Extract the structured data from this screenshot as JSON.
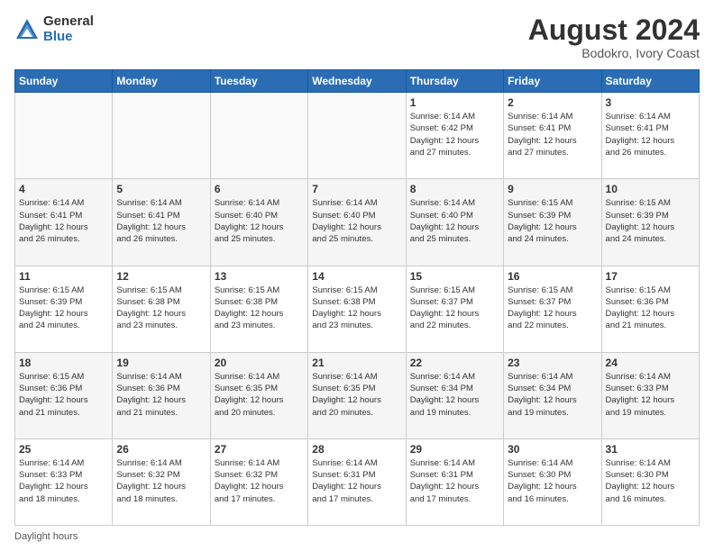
{
  "logo": {
    "general": "General",
    "blue": "Blue"
  },
  "title": {
    "month": "August 2024",
    "location": "Bodokro, Ivory Coast"
  },
  "weekdays": [
    "Sunday",
    "Monday",
    "Tuesday",
    "Wednesday",
    "Thursday",
    "Friday",
    "Saturday"
  ],
  "footer": "Daylight hours",
  "weeks": [
    [
      {
        "day": "",
        "info": ""
      },
      {
        "day": "",
        "info": ""
      },
      {
        "day": "",
        "info": ""
      },
      {
        "day": "",
        "info": ""
      },
      {
        "day": "1",
        "info": "Sunrise: 6:14 AM\nSunset: 6:42 PM\nDaylight: 12 hours\nand 27 minutes."
      },
      {
        "day": "2",
        "info": "Sunrise: 6:14 AM\nSunset: 6:41 PM\nDaylight: 12 hours\nand 27 minutes."
      },
      {
        "day": "3",
        "info": "Sunrise: 6:14 AM\nSunset: 6:41 PM\nDaylight: 12 hours\nand 26 minutes."
      }
    ],
    [
      {
        "day": "4",
        "info": "Sunrise: 6:14 AM\nSunset: 6:41 PM\nDaylight: 12 hours\nand 26 minutes."
      },
      {
        "day": "5",
        "info": "Sunrise: 6:14 AM\nSunset: 6:41 PM\nDaylight: 12 hours\nand 26 minutes."
      },
      {
        "day": "6",
        "info": "Sunrise: 6:14 AM\nSunset: 6:40 PM\nDaylight: 12 hours\nand 25 minutes."
      },
      {
        "day": "7",
        "info": "Sunrise: 6:14 AM\nSunset: 6:40 PM\nDaylight: 12 hours\nand 25 minutes."
      },
      {
        "day": "8",
        "info": "Sunrise: 6:14 AM\nSunset: 6:40 PM\nDaylight: 12 hours\nand 25 minutes."
      },
      {
        "day": "9",
        "info": "Sunrise: 6:15 AM\nSunset: 6:39 PM\nDaylight: 12 hours\nand 24 minutes."
      },
      {
        "day": "10",
        "info": "Sunrise: 6:15 AM\nSunset: 6:39 PM\nDaylight: 12 hours\nand 24 minutes."
      }
    ],
    [
      {
        "day": "11",
        "info": "Sunrise: 6:15 AM\nSunset: 6:39 PM\nDaylight: 12 hours\nand 24 minutes."
      },
      {
        "day": "12",
        "info": "Sunrise: 6:15 AM\nSunset: 6:38 PM\nDaylight: 12 hours\nand 23 minutes."
      },
      {
        "day": "13",
        "info": "Sunrise: 6:15 AM\nSunset: 6:38 PM\nDaylight: 12 hours\nand 23 minutes."
      },
      {
        "day": "14",
        "info": "Sunrise: 6:15 AM\nSunset: 6:38 PM\nDaylight: 12 hours\nand 23 minutes."
      },
      {
        "day": "15",
        "info": "Sunrise: 6:15 AM\nSunset: 6:37 PM\nDaylight: 12 hours\nand 22 minutes."
      },
      {
        "day": "16",
        "info": "Sunrise: 6:15 AM\nSunset: 6:37 PM\nDaylight: 12 hours\nand 22 minutes."
      },
      {
        "day": "17",
        "info": "Sunrise: 6:15 AM\nSunset: 6:36 PM\nDaylight: 12 hours\nand 21 minutes."
      }
    ],
    [
      {
        "day": "18",
        "info": "Sunrise: 6:15 AM\nSunset: 6:36 PM\nDaylight: 12 hours\nand 21 minutes."
      },
      {
        "day": "19",
        "info": "Sunrise: 6:14 AM\nSunset: 6:36 PM\nDaylight: 12 hours\nand 21 minutes."
      },
      {
        "day": "20",
        "info": "Sunrise: 6:14 AM\nSunset: 6:35 PM\nDaylight: 12 hours\nand 20 minutes."
      },
      {
        "day": "21",
        "info": "Sunrise: 6:14 AM\nSunset: 6:35 PM\nDaylight: 12 hours\nand 20 minutes."
      },
      {
        "day": "22",
        "info": "Sunrise: 6:14 AM\nSunset: 6:34 PM\nDaylight: 12 hours\nand 19 minutes."
      },
      {
        "day": "23",
        "info": "Sunrise: 6:14 AM\nSunset: 6:34 PM\nDaylight: 12 hours\nand 19 minutes."
      },
      {
        "day": "24",
        "info": "Sunrise: 6:14 AM\nSunset: 6:33 PM\nDaylight: 12 hours\nand 19 minutes."
      }
    ],
    [
      {
        "day": "25",
        "info": "Sunrise: 6:14 AM\nSunset: 6:33 PM\nDaylight: 12 hours\nand 18 minutes."
      },
      {
        "day": "26",
        "info": "Sunrise: 6:14 AM\nSunset: 6:32 PM\nDaylight: 12 hours\nand 18 minutes."
      },
      {
        "day": "27",
        "info": "Sunrise: 6:14 AM\nSunset: 6:32 PM\nDaylight: 12 hours\nand 17 minutes."
      },
      {
        "day": "28",
        "info": "Sunrise: 6:14 AM\nSunset: 6:31 PM\nDaylight: 12 hours\nand 17 minutes."
      },
      {
        "day": "29",
        "info": "Sunrise: 6:14 AM\nSunset: 6:31 PM\nDaylight: 12 hours\nand 17 minutes."
      },
      {
        "day": "30",
        "info": "Sunrise: 6:14 AM\nSunset: 6:30 PM\nDaylight: 12 hours\nand 16 minutes."
      },
      {
        "day": "31",
        "info": "Sunrise: 6:14 AM\nSunset: 6:30 PM\nDaylight: 12 hours\nand 16 minutes."
      }
    ]
  ]
}
